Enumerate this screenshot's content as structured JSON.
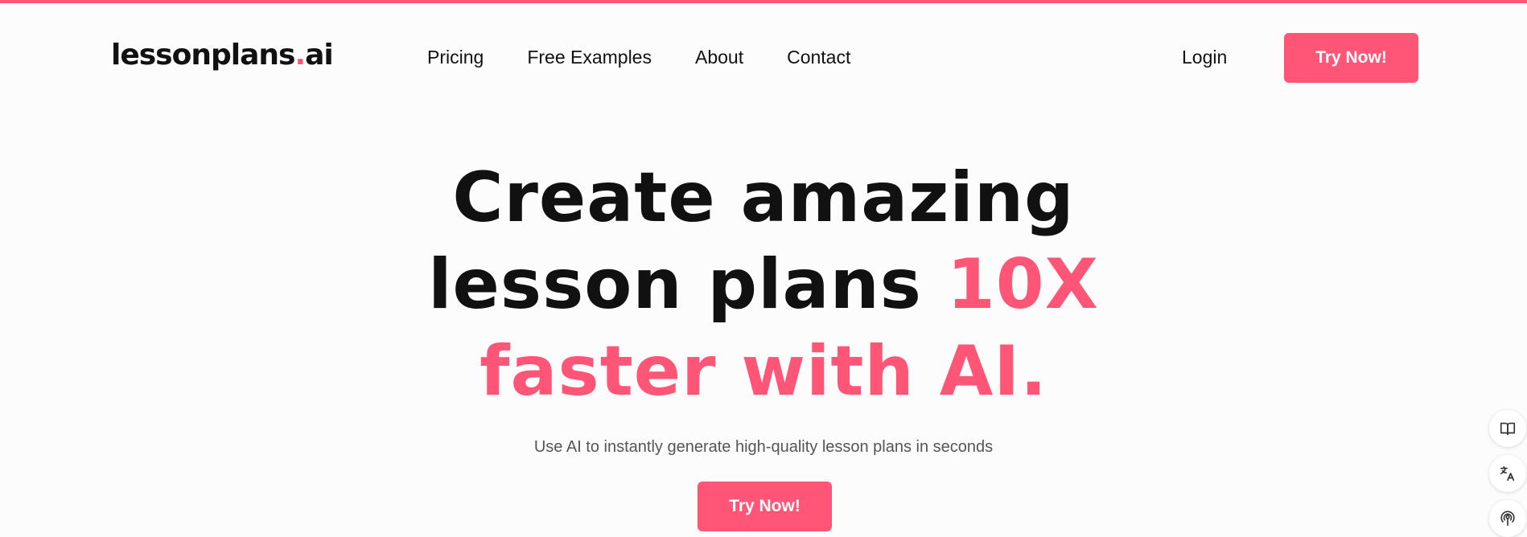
{
  "header": {
    "logo_main": "lessonplans",
    "logo_dot": ".",
    "logo_tld": "ai",
    "nav": [
      {
        "label": "Pricing"
      },
      {
        "label": "Free Examples"
      },
      {
        "label": "About"
      },
      {
        "label": "Contact"
      }
    ],
    "login_label": "Login",
    "cta_label": "Try Now!"
  },
  "hero": {
    "title_line1": "Create amazing",
    "title_line2_plain": "lesson plans ",
    "title_line2_accent": "10X",
    "title_line3_accent": "faster with AI.",
    "subtitle": "Use AI to instantly generate high-quality lesson plans in seconds",
    "cta_label": "Try Now!"
  },
  "side_tools": [
    {
      "icon": "book-open-icon"
    },
    {
      "icon": "translate-icon"
    },
    {
      "icon": "podcast-icon"
    }
  ],
  "colors": {
    "accent": "#ff5577",
    "text": "#111111",
    "muted": "#555555",
    "background": "#fcfcfc"
  }
}
